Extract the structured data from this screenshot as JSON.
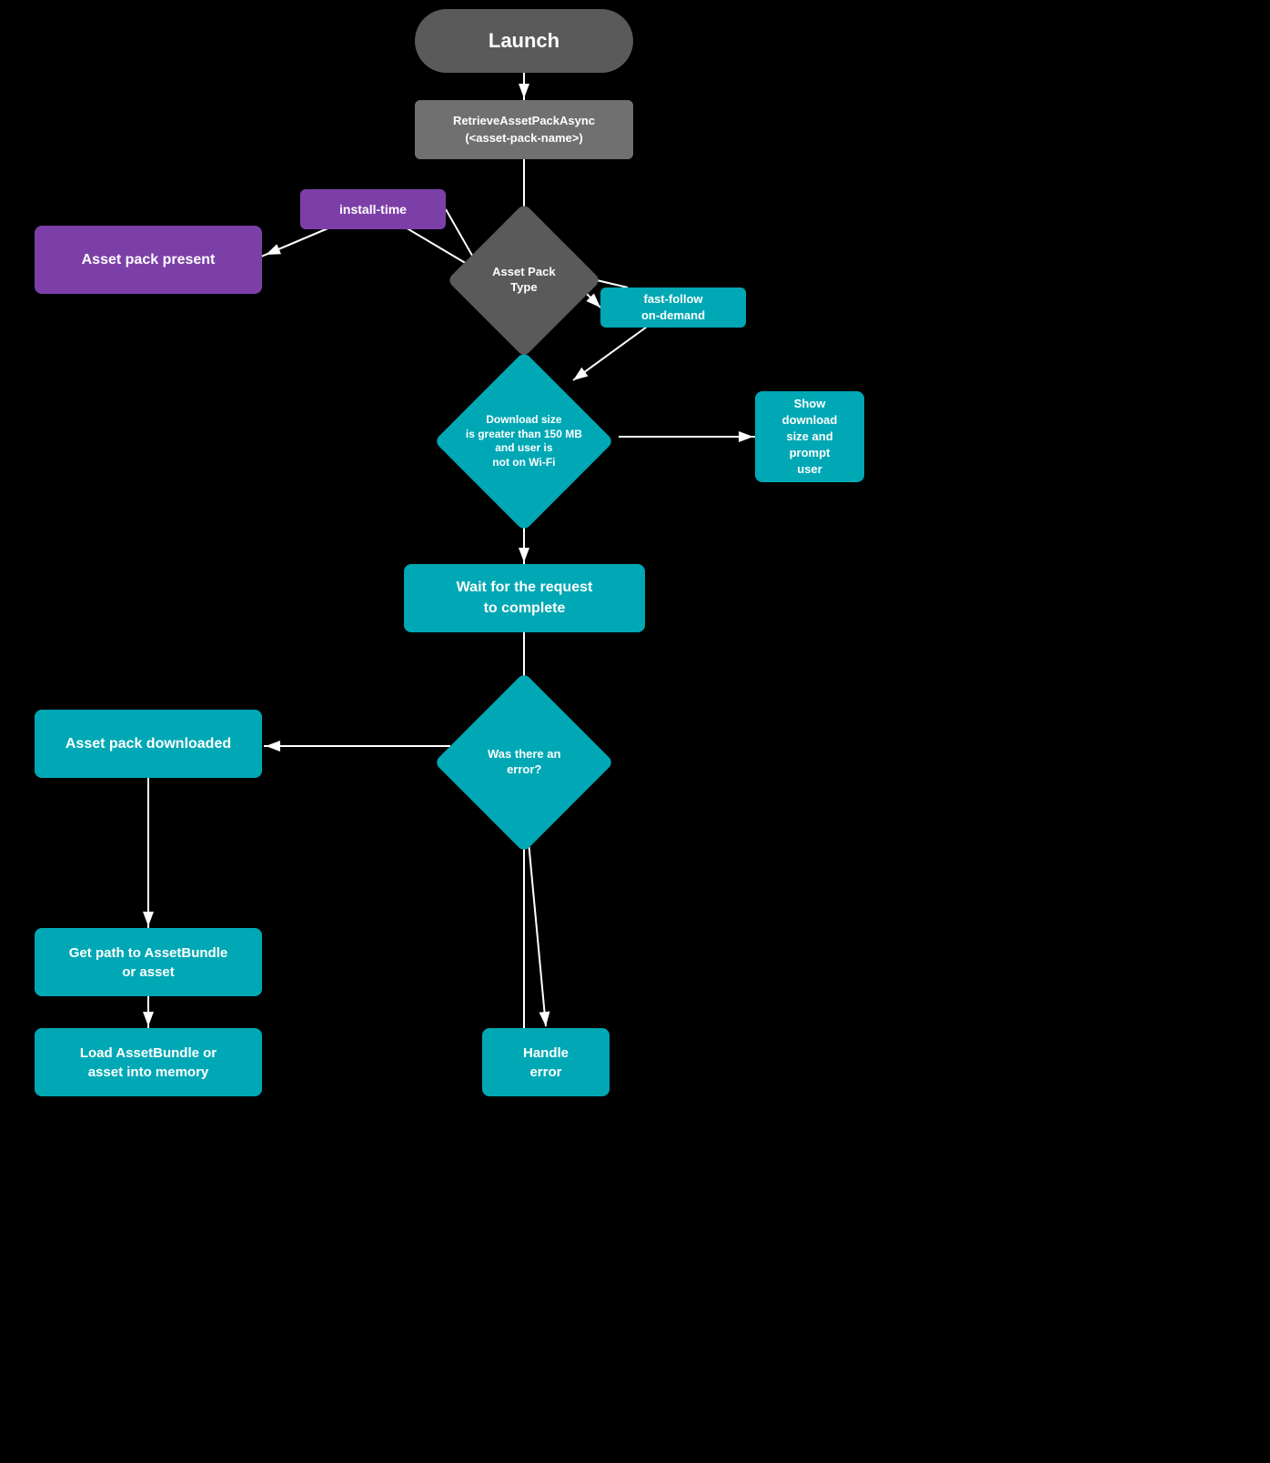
{
  "nodes": {
    "launch": {
      "label": "Launch"
    },
    "retrieve": {
      "label": "RetrieveAssetPackAsync\n(<asset-pack-name>)"
    },
    "installtime": {
      "label": "install-time"
    },
    "fastfollow": {
      "label": "fast-follow\non-demand"
    },
    "assetpacktype": {
      "label": "Asset Pack\nType"
    },
    "assetpresent": {
      "label": "Asset pack present"
    },
    "downloadsize": {
      "label": "Download size\nis greater than 150 MB\nand user is\nnot on Wi-Fi"
    },
    "showdownload": {
      "label": "Show\ndownload\nsize and\nprompt\nuser"
    },
    "waitrequest": {
      "label": "Wait for the request\nto complete"
    },
    "assetdownloaded": {
      "label": "Asset pack downloaded"
    },
    "waserror": {
      "label": "Was there an\nerror?"
    },
    "getpath": {
      "label": "Get path to AssetBundle\nor asset"
    },
    "loadasset": {
      "label": "Load AssetBundle or\nasset into memory"
    },
    "handleerror": {
      "label": "Handle\nerror"
    }
  }
}
